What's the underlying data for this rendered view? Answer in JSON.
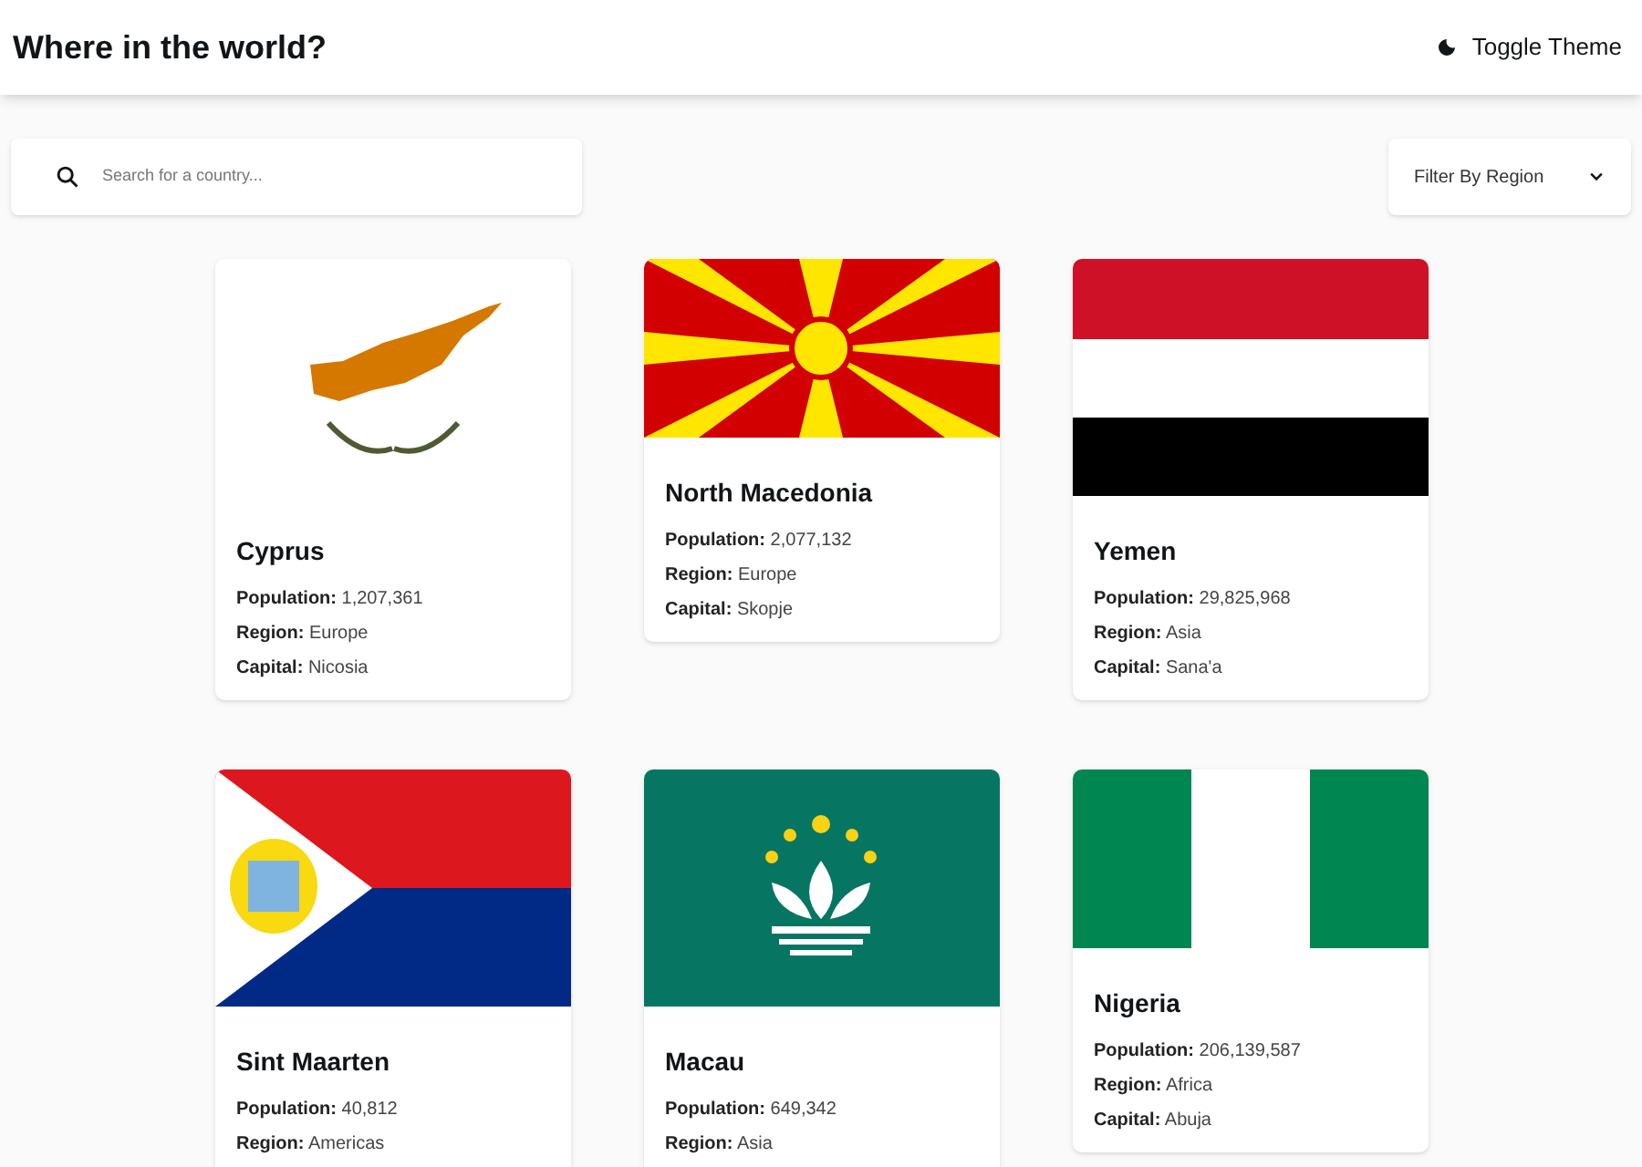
{
  "header": {
    "title": "Where in the world?",
    "theme_toggle": "Toggle Theme"
  },
  "search": {
    "placeholder": "Search for a country..."
  },
  "filter": {
    "label": "Filter By Region"
  },
  "countries": [
    {
      "kind": "cyprus",
      "name": "Cyprus",
      "facts": [
        {
          "label": "Population:",
          "value": "1,207,361"
        },
        {
          "label": "Region:",
          "value": "Europe"
        },
        {
          "label": "Capital:",
          "value": "Nicosia"
        }
      ]
    },
    {
      "kind": "macedonia",
      "name": "North Macedonia",
      "facts": [
        {
          "label": "Population:",
          "value": "2,077,132"
        },
        {
          "label": "Region:",
          "value": "Europe"
        },
        {
          "label": "Capital:",
          "value": "Skopje"
        }
      ]
    },
    {
      "kind": "yemen",
      "name": "Yemen",
      "facts": [
        {
          "label": "Population:",
          "value": "29,825,968"
        },
        {
          "label": "Region:",
          "value": "Asia"
        },
        {
          "label": "Capital:",
          "value": "Sana'a"
        }
      ]
    },
    {
      "kind": "sint_maarten",
      "name": "Sint Maarten",
      "facts": [
        {
          "label": "Population:",
          "value": "40,812"
        },
        {
          "label": "Region:",
          "value": "Americas"
        }
      ]
    },
    {
      "kind": "macau",
      "name": "Macau",
      "facts": [
        {
          "label": "Population:",
          "value": "649,342"
        },
        {
          "label": "Region:",
          "value": "Asia"
        }
      ]
    },
    {
      "kind": "nigeria",
      "name": "Nigeria",
      "facts": [
        {
          "label": "Population:",
          "value": "206,139,587"
        },
        {
          "label": "Region:",
          "value": "Africa"
        },
        {
          "label": "Capital:",
          "value": "Abuja"
        }
      ]
    }
  ]
}
